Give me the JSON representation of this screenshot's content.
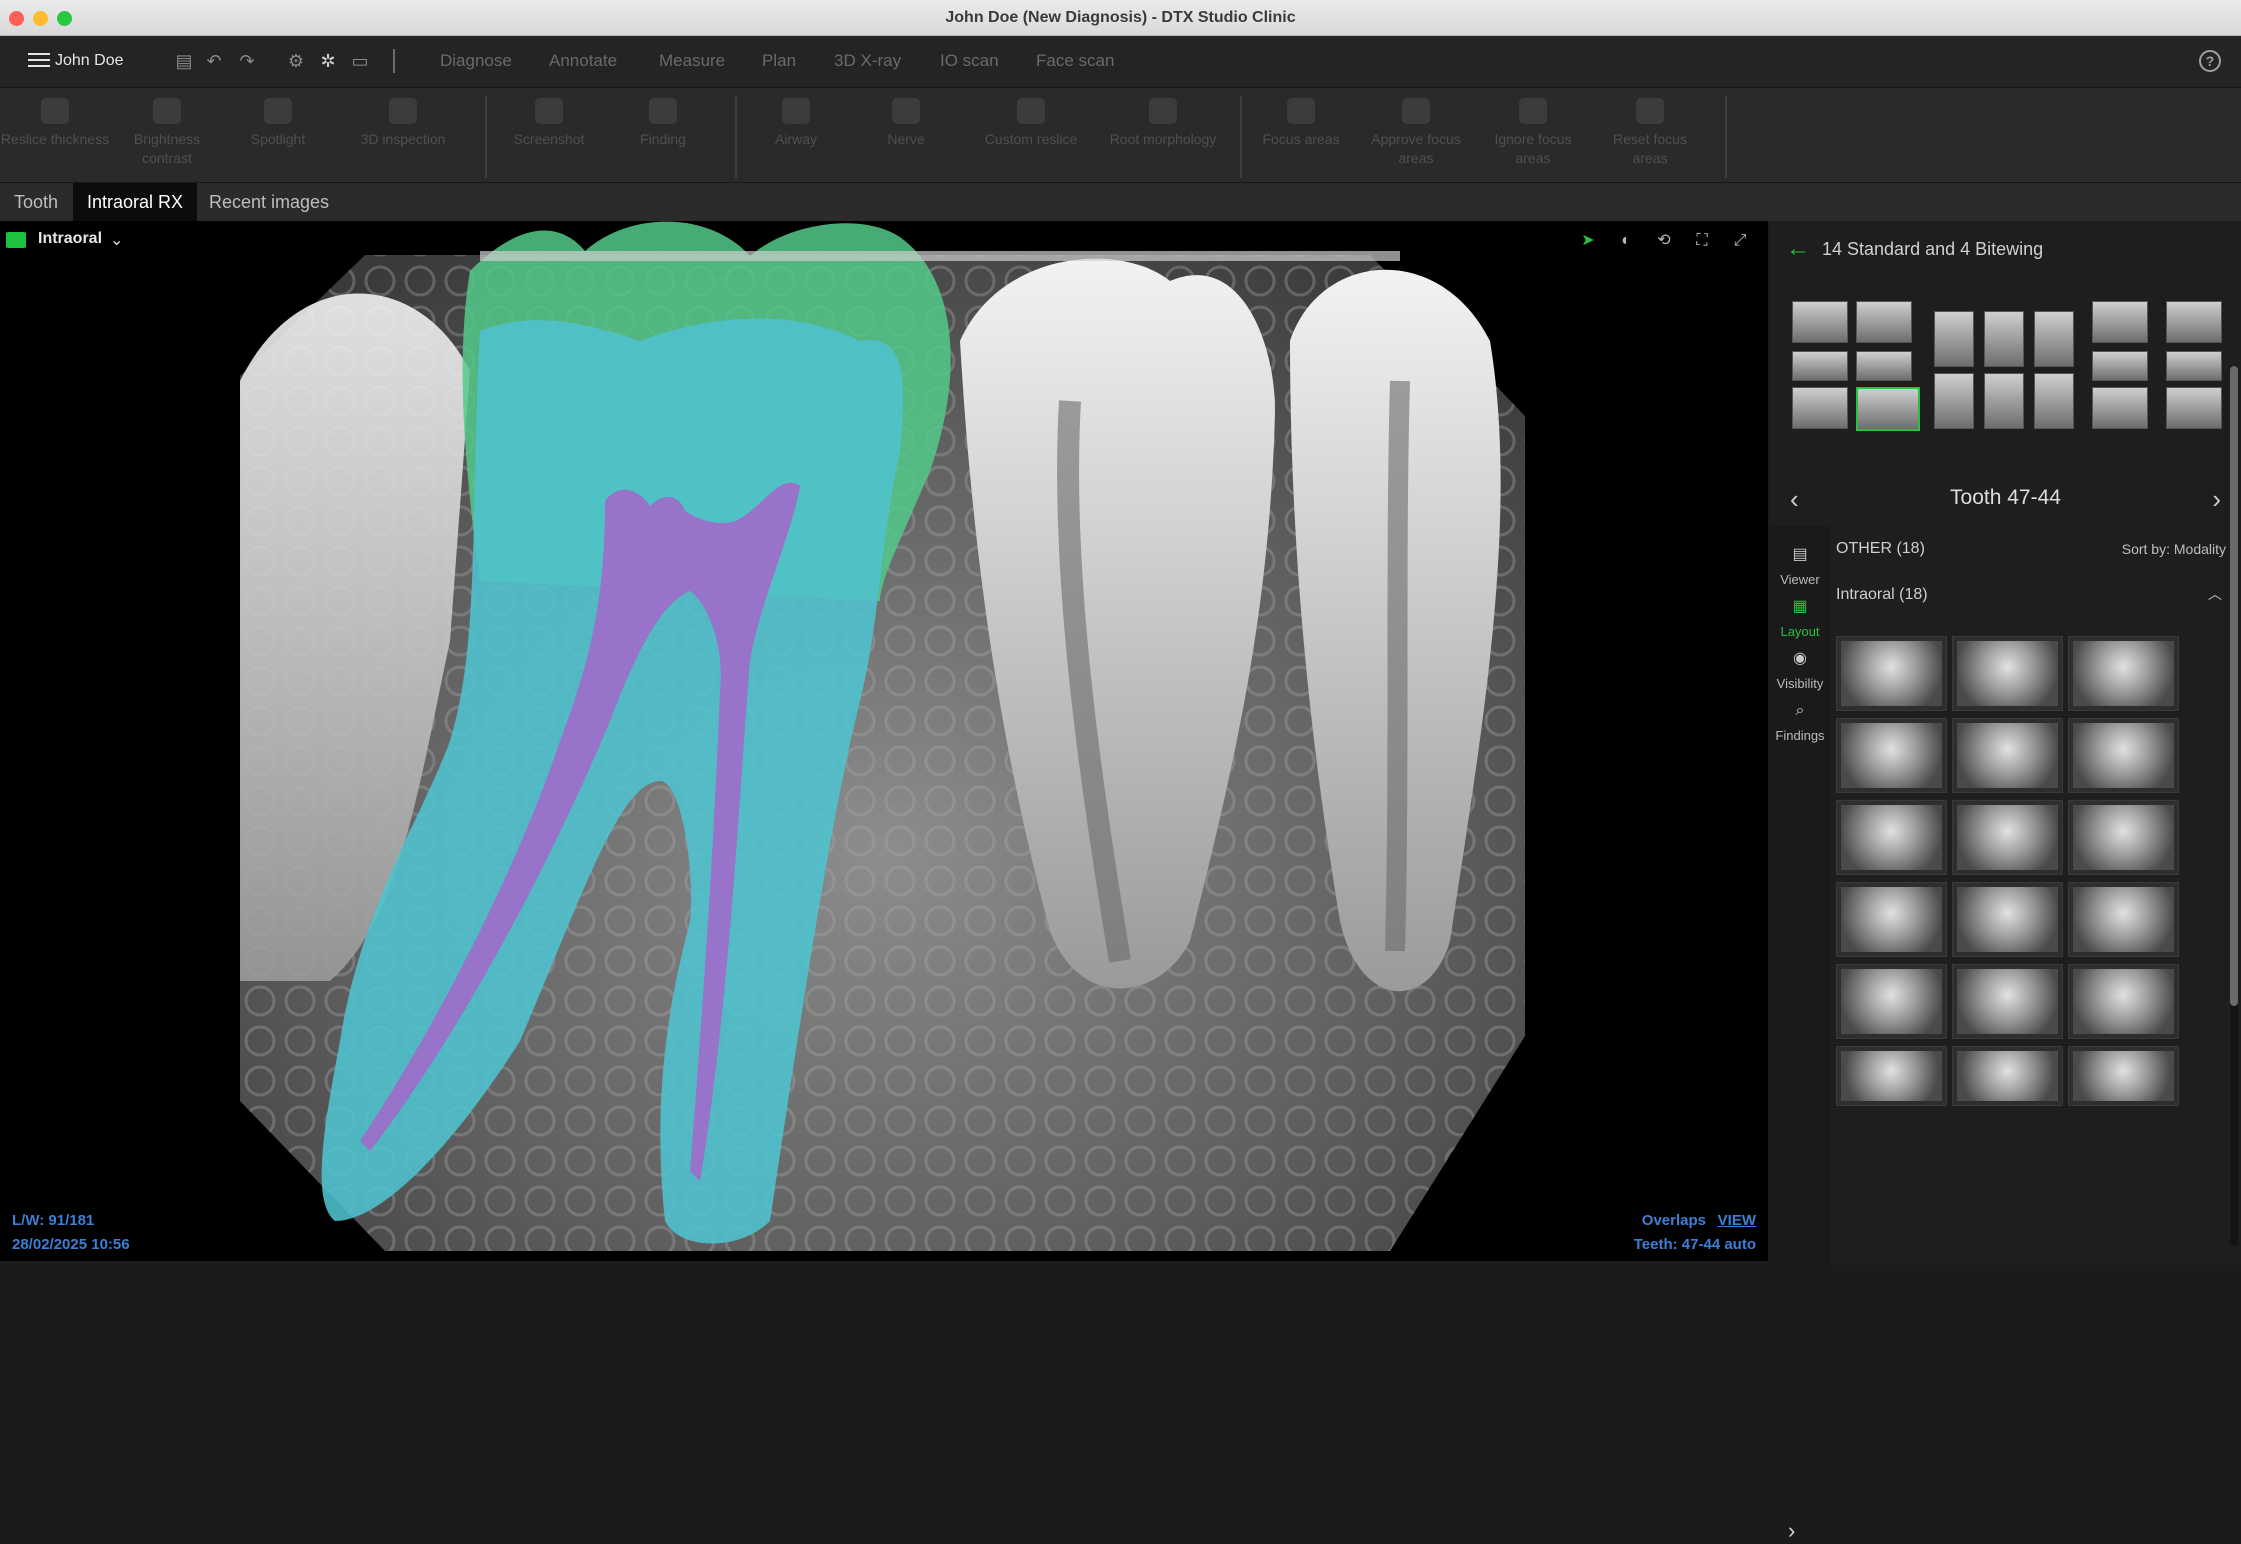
{
  "window": {
    "title": "John Doe (New Diagnosis) - DTX Studio Clinic"
  },
  "menubar": {
    "user": "John Doe",
    "nav": [
      "Diagnose",
      "Annotate",
      "Measure",
      "Plan",
      "3D X-ray",
      "IO scan",
      "Face scan"
    ],
    "help": "?"
  },
  "toolbar": {
    "tools": [
      "Reslice thickness",
      "Brightness contrast",
      "Spotlight",
      "3D inspection",
      "Screenshot",
      "Finding",
      "Airway",
      "Nerve",
      "Custom reslice",
      "Root morphology",
      "Focus areas",
      "Approve focus areas",
      "Ignore focus areas",
      "Reset focus areas"
    ]
  },
  "tabs": [
    "Tooth",
    "Intraoral RX",
    "Recent images"
  ],
  "viewer": {
    "label": "Intraoral",
    "lw": "L/W: 91/181",
    "timestamp": "28/02/2025 10:56",
    "overlaps": "Overlaps",
    "view": "VIEW",
    "teeth": "Teeth: 47-44 auto"
  },
  "panel": {
    "title": "14 Standard and 4 Bitewing",
    "nav_title": "Tooth 47-44",
    "sidebar": [
      "Viewer",
      "Layout",
      "Visibility",
      "Findings"
    ],
    "other": "OTHER (18)",
    "sort": "Sort by: Modality",
    "intraoral": "Intraoral (18)"
  },
  "colors": {
    "accent": "#25c23d",
    "link": "#3d7fd4",
    "enamel": "#54c98a",
    "dentin": "#4fc3cf",
    "pulp": "#9b6fc9"
  }
}
